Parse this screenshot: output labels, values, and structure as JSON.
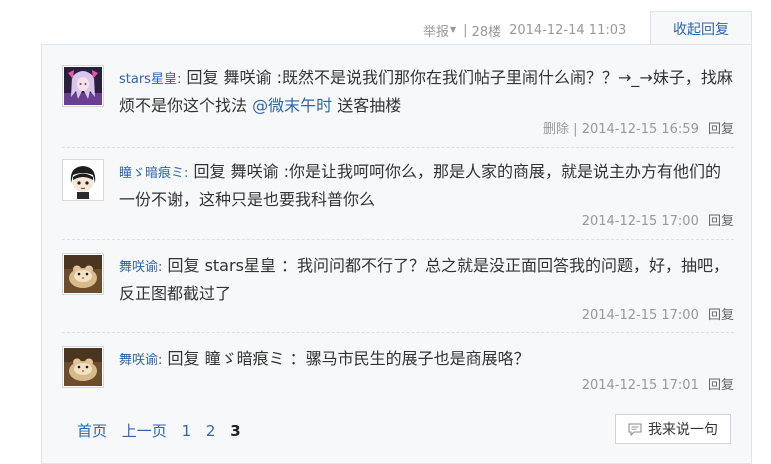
{
  "header": {
    "report_label": "举报",
    "separator": "|",
    "floor": "28楼",
    "datetime": "2014-12-14 11:03",
    "collapse_label": "收起回复"
  },
  "comments": [
    {
      "avatar_icon": "anime-girl-avatar-icon",
      "username": "stars星皇:",
      "text": "回复 舞咲谕 :既然不是说我们那你在我们帖子里闹什么闹？？→_→妹子，找麻烦不是你这个找法",
      "mention": "@微末午时",
      "text_after": "送客抽楼",
      "delete_label": "删除",
      "separator": "|",
      "datetime": "2014-12-15 16:59",
      "reply_label": "回复"
    },
    {
      "avatar_icon": "cartoon-boy-avatar-icon",
      "username": "瞳ゞ暗痕ミ:",
      "text": "回复 舞咲谕 :你是让我呵呵你么，那是人家的商展，就是说主办方有他们的一份不谢，这种只是也要我科普你么",
      "datetime": "2014-12-15 17:00",
      "reply_label": "回复"
    },
    {
      "avatar_icon": "hamster-avatar-icon",
      "username": "舞咲谕:",
      "text": "回复 stars星皇 ：我问问都不行了？总之就是没正面回答我的问题，好，抽吧，反正图都截过了",
      "datetime": "2014-12-15 17:00",
      "reply_label": "回复"
    },
    {
      "avatar_icon": "hamster-avatar-icon",
      "username": "舞咲谕:",
      "text": "回复 瞳ゞ暗痕ミ ：骡马市民生的展子也是商展咯？",
      "datetime": "2014-12-15 17:01",
      "reply_label": "回复"
    }
  ],
  "pagination": {
    "first": "首页",
    "prev": "上一页",
    "pages": [
      "1",
      "2",
      "3"
    ],
    "current": "3"
  },
  "say_button_label": "我来说一句",
  "colors": {
    "link": "#2d64b3",
    "muted": "#999999",
    "panel_bg": "#f7f8fa",
    "border": "#e1e4ea"
  }
}
